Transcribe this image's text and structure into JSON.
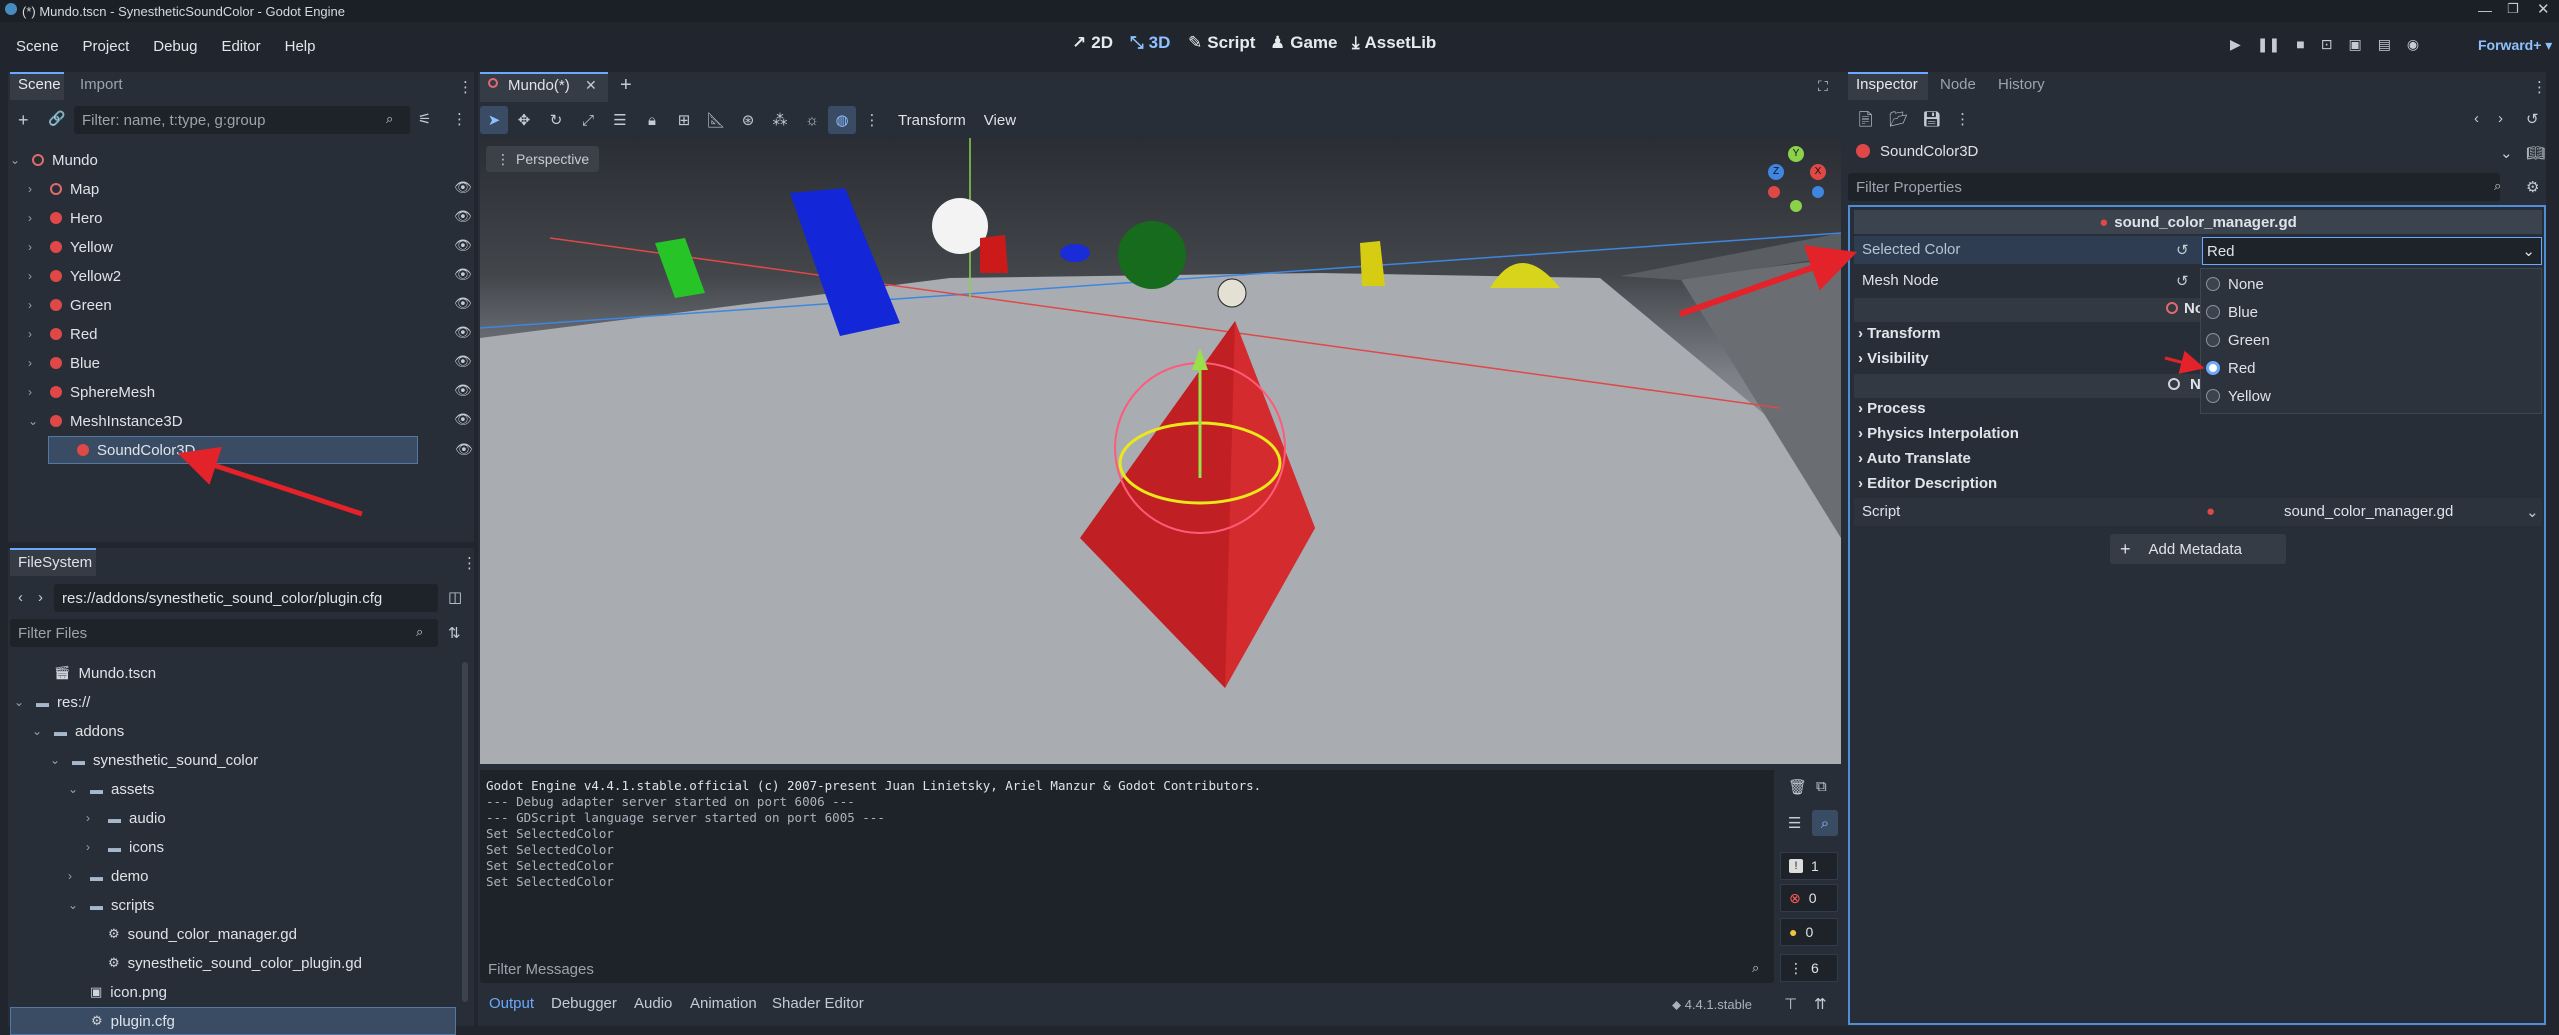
{
  "window": {
    "title": "(*) Mundo.tscn - SynestheticSoundColor - Godot Engine"
  },
  "menu": [
    "Scene",
    "Project",
    "Debug",
    "Editor",
    "Help"
  ],
  "main_buttons": {
    "d2": "2D",
    "d3": "3D",
    "script": "Script",
    "game": "Game",
    "assetlib": "AssetLib"
  },
  "renderer": "Forward+",
  "scene_dock": {
    "tab_scene": "Scene",
    "tab_import": "Import",
    "filter_placeholder": "Filter: name, t:type, g:group",
    "nodes": [
      {
        "label": "Mundo",
        "depth": 0
      },
      {
        "label": "Map",
        "depth": 1
      },
      {
        "label": "Hero",
        "depth": 1
      },
      {
        "label": "Yellow",
        "depth": 1
      },
      {
        "label": "Yellow2",
        "depth": 1
      },
      {
        "label": "Green",
        "depth": 1
      },
      {
        "label": "Red",
        "depth": 1
      },
      {
        "label": "Blue",
        "depth": 1
      },
      {
        "label": "SphereMesh",
        "depth": 1
      },
      {
        "label": "MeshInstance3D",
        "depth": 1
      },
      {
        "label": "SoundColor3D",
        "depth": 2
      }
    ]
  },
  "filesystem": {
    "tab": "FileSystem",
    "path": "res://addons/synesthetic_sound_color/plugin.cfg",
    "filter_placeholder": "Filter Files",
    "items": [
      {
        "label": "Mundo.tscn",
        "depth": 1
      },
      {
        "label": "res://",
        "depth": 0
      },
      {
        "label": "addons",
        "depth": 1
      },
      {
        "label": "synesthetic_sound_color",
        "depth": 2
      },
      {
        "label": "assets",
        "depth": 3
      },
      {
        "label": "audio",
        "depth": 4
      },
      {
        "label": "icons",
        "depth": 4
      },
      {
        "label": "demo",
        "depth": 3
      },
      {
        "label": "scripts",
        "depth": 3
      },
      {
        "label": "sound_color_manager.gd",
        "depth": 4
      },
      {
        "label": "synesthetic_sound_color_plugin.gd",
        "depth": 4
      },
      {
        "label": "icon.png",
        "depth": 3
      },
      {
        "label": "plugin.cfg",
        "depth": 3
      }
    ]
  },
  "editor": {
    "tab": "Mundo(*)",
    "toolbar_transform": "Transform",
    "toolbar_view": "View",
    "perspective": "Perspective",
    "gizmo_y": "Y",
    "gizmo_x": "X",
    "gizmo_z": "Z"
  },
  "output": {
    "lines": [
      "Godot Engine v4.4.1.stable.official (c) 2007-present Juan Linietsky, Ariel Manzur & Godot Contributors.",
      "--- Debug adapter server started on port 6006 ---",
      "--- GDScript language server started on port 6005 ---",
      "Set SelectedColor",
      "Set SelectedColor",
      "Set SelectedColor",
      "Set SelectedColor"
    ],
    "counts": {
      "errors_all": "1",
      "errors": "0",
      "warnings": "0",
      "messages": "6"
    },
    "filter_placeholder": "Filter Messages",
    "version": "4.4.1.stable"
  },
  "bottom_tabs": [
    "Output",
    "Debugger",
    "Audio",
    "Animation",
    "Shader Editor"
  ],
  "inspector": {
    "tab_inspector": "Inspector",
    "tab_node": "Node",
    "tab_history": "History",
    "object": "SoundColor3D",
    "filter_placeholder": "Filter Properties",
    "script_header": "sound_color_manager.gd",
    "selected_color_label": "Selected Color",
    "selected_color_value": "Red",
    "mesh_node_label": "Mesh Node",
    "mesh_node_value": "No",
    "second_value": "N",
    "sections": [
      "Transform",
      "Visibility",
      "Process",
      "Physics Interpolation",
      "Auto Translate",
      "Editor Description"
    ],
    "script_label": "Script",
    "script_value": "sound_color_manager.gd",
    "add_metadata": "Add Metadata",
    "dropdown": [
      {
        "label": "None",
        "checked": false
      },
      {
        "label": "Blue",
        "checked": false
      },
      {
        "label": "Green",
        "checked": false
      },
      {
        "label": "Red",
        "checked": true
      },
      {
        "label": "Yellow",
        "checked": false
      }
    ]
  },
  "colors": {
    "accent": "#6aa9ff",
    "annotation_arrow": "#e3222a",
    "bg": "#21262e",
    "panel": "#282e37"
  }
}
